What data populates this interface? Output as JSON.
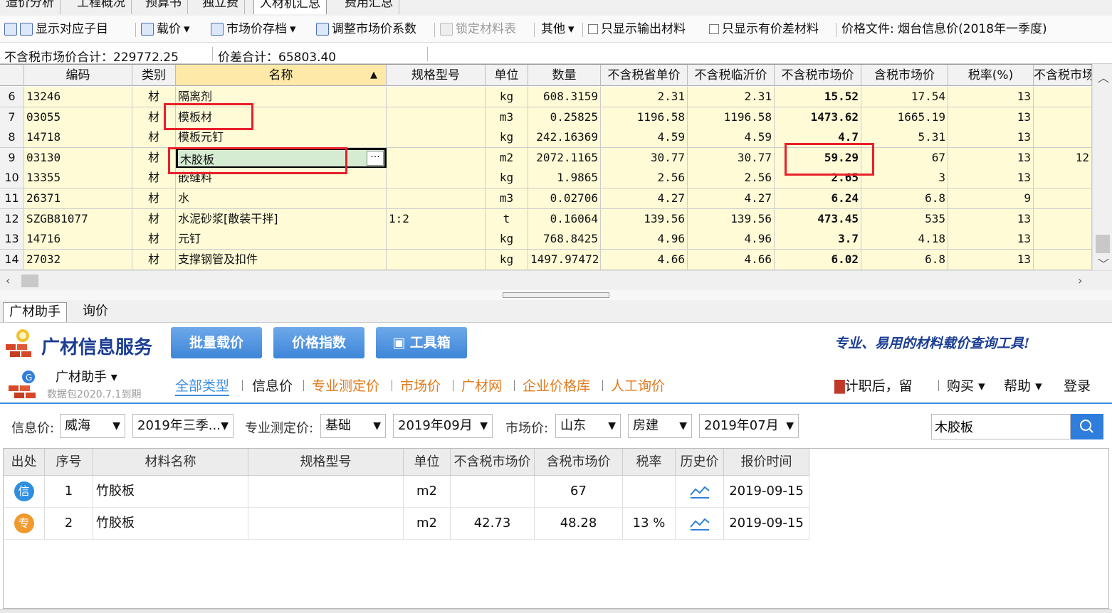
{
  "tabs": [
    "造价分析",
    "工程概况",
    "预算书",
    "独立费",
    "人材机汇总",
    "费用汇总"
  ],
  "toolbar": {
    "show_sub": "显示对应子目",
    "load_price": "载价",
    "market_archive": "市场价存档",
    "adjust_coef": "调整市场价系数",
    "lock_table": "锁定材料表",
    "other": "其他",
    "only_output": "只显示输出材料",
    "only_diff": "只显示有价差材料",
    "price_file": "价格文件: 烟台信息价(2018年一季度)"
  },
  "totals": {
    "market_total": "不含税市场价合计：229772.25",
    "diff_total": "价差合计：65803.40"
  },
  "grid": {
    "headers": [
      "编码",
      "类别",
      "名称",
      "规格型号",
      "单位",
      "数量",
      "不含税省单价",
      "不含税临沂价",
      "不含税市场价",
      "含税市场价",
      "税率(%)",
      "不含税市场"
    ],
    "rows": [
      {
        "n": "6",
        "code": "13246",
        "type": "材",
        "name": "隔离剂",
        "spec": "",
        "unit": "kg",
        "qty": "608.3159",
        "p1": "2.31",
        "p2": "2.31",
        "p3": "15.52",
        "p4": "17.54",
        "tax": "13",
        "last": ""
      },
      {
        "n": "7",
        "code": "03055",
        "type": "材",
        "name": "模板材",
        "spec": "",
        "unit": "m3",
        "qty": "0.25825",
        "p1": "1196.58",
        "p2": "1196.58",
        "p3": "1473.62",
        "p4": "1665.19",
        "tax": "13",
        "last": ""
      },
      {
        "n": "8",
        "code": "14718",
        "type": "材",
        "name": "模板元钉",
        "spec": "",
        "unit": "kg",
        "qty": "242.16369",
        "p1": "4.59",
        "p2": "4.59",
        "p3": "4.7",
        "p4": "5.31",
        "tax": "13",
        "last": ""
      },
      {
        "n": "9",
        "code": "03130",
        "type": "材",
        "name": "木胶板",
        "spec": "",
        "unit": "m2",
        "qty": "2072.1165",
        "p1": "30.77",
        "p2": "30.77",
        "p3": "59.29",
        "p4": "67",
        "tax": "13",
        "last": "12"
      },
      {
        "n": "10",
        "code": "13355",
        "type": "材",
        "name": "嵌缝料",
        "spec": "",
        "unit": "kg",
        "qty": "1.9865",
        "p1": "2.56",
        "p2": "2.56",
        "p3": "2.65",
        "p4": "3",
        "tax": "13",
        "last": ""
      },
      {
        "n": "11",
        "code": "26371",
        "type": "材",
        "name": "水",
        "spec": "",
        "unit": "m3",
        "qty": "0.02706",
        "p1": "4.27",
        "p2": "4.27",
        "p3": "6.24",
        "p4": "6.8",
        "tax": "9",
        "last": ""
      },
      {
        "n": "12",
        "code": "SZGB81077",
        "type": "材",
        "name": "水泥砂浆[散装干拌]",
        "spec": "1:2",
        "unit": "t",
        "qty": "0.16064",
        "p1": "139.56",
        "p2": "139.56",
        "p3": "473.45",
        "p4": "535",
        "tax": "13",
        "last": ""
      },
      {
        "n": "13",
        "code": "14716",
        "type": "材",
        "name": "元钉",
        "spec": "",
        "unit": "kg",
        "qty": "768.8425",
        "p1": "4.96",
        "p2": "4.96",
        "p3": "3.7",
        "p4": "4.18",
        "tax": "13",
        "last": ""
      },
      {
        "n": "14",
        "code": "27032",
        "type": "材",
        "name": "支撑钢管及扣件",
        "spec": "",
        "unit": "kg",
        "qty": "1497.97472",
        "p1": "4.66",
        "p2": "4.66",
        "p3": "6.02",
        "p4": "6.8",
        "tax": "13",
        "last": ""
      }
    ]
  },
  "bottom_tabs": [
    "广材助手",
    "询价"
  ],
  "gc": {
    "brand": "广材信息服务",
    "btn_batch": "批量载价",
    "btn_index": "价格指数",
    "btn_tools": "工具箱",
    "slogan": "专业、易用的材料载价查询工具!",
    "assistant": "广材助手",
    "expiry": "数据包2020.7.1到期",
    "nav": [
      "全部类型",
      "信息价",
      "专业测定价",
      "市场价",
      "广材网",
      "企业价格库",
      "人工询价"
    ],
    "right_links": {
      "msg": "计职后，留",
      "buy": "购买",
      "help": "帮助",
      "login": "登录"
    }
  },
  "filters": {
    "info_label": "信息价:",
    "info_city": "威海",
    "info_period": "2019年三季...",
    "prof_label": "专业测定价:",
    "prof_type": "基础",
    "prof_month": "2019年09月",
    "market_label": "市场价:",
    "market_prov": "山东",
    "market_type": "房建",
    "market_month": "2019年07月",
    "search_value": "木胶板"
  },
  "results": {
    "headers": [
      "出处",
      "序号",
      "材料名称",
      "规格型号",
      "单位",
      "不含税市场价",
      "含税市场价",
      "税率",
      "历史价",
      "报价时间"
    ],
    "rows": [
      {
        "src": "信",
        "src_color": "#2e8fe0",
        "no": "1",
        "name": "竹胶板",
        "spec": "",
        "unit": "m2",
        "ex": "",
        "inc": "67",
        "tax": "",
        "date": "2019-09-15"
      },
      {
        "src": "专",
        "src_color": "#f09a2e",
        "no": "2",
        "name": "竹胶板",
        "spec": "",
        "unit": "m2",
        "ex": "42.73",
        "inc": "48.28",
        "tax": "13 %",
        "date": "2019-09-15"
      }
    ]
  }
}
